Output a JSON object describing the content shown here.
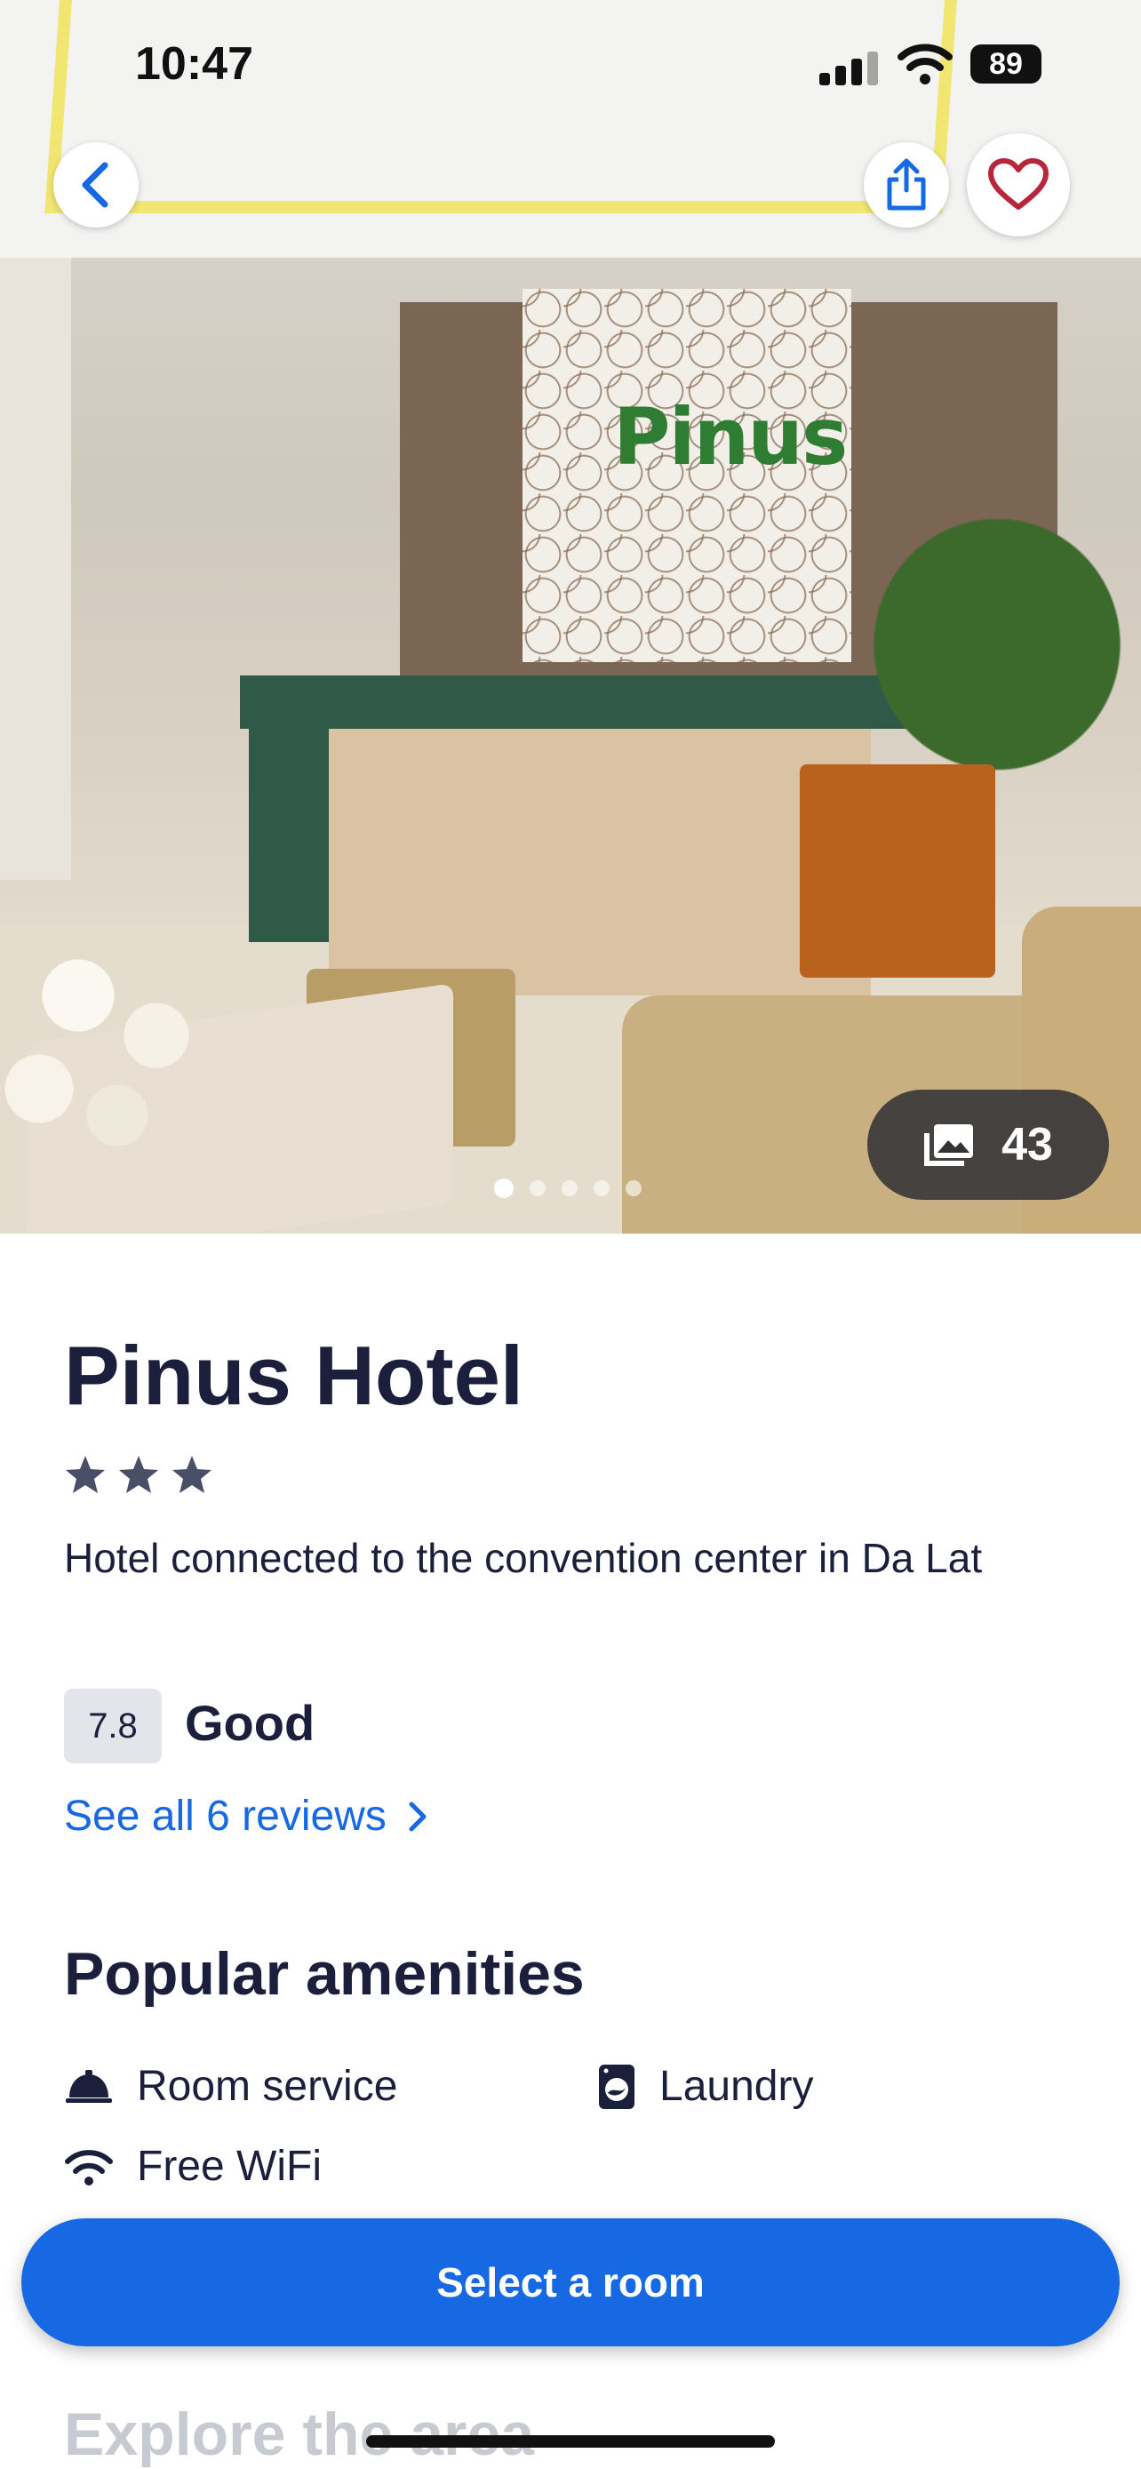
{
  "status_bar": {
    "time": "10:47",
    "battery": "89"
  },
  "gallery": {
    "photo_count": "43",
    "dots_total": 5,
    "active_dot": 0
  },
  "hotel": {
    "name": "Pinus Hotel",
    "star_rating": 3,
    "tagline": "Hotel connected to the convention center in Da Lat",
    "rating_score": "7.8",
    "rating_label": "Good",
    "reviews_link": "See all 6 reviews"
  },
  "amenities": {
    "title": "Popular amenities",
    "items": [
      {
        "label": "Room service",
        "icon": "room-service-bell-icon"
      },
      {
        "label": "Laundry",
        "icon": "laundry-icon"
      },
      {
        "label": "Free WiFi",
        "icon": "wifi-icon"
      }
    ]
  },
  "cta": {
    "label": "Select a room"
  },
  "next_section": {
    "title": "Explore the area"
  },
  "colors": {
    "accent": "#1668e3",
    "text": "#1b1f3b",
    "favorite": "#b8263c"
  }
}
